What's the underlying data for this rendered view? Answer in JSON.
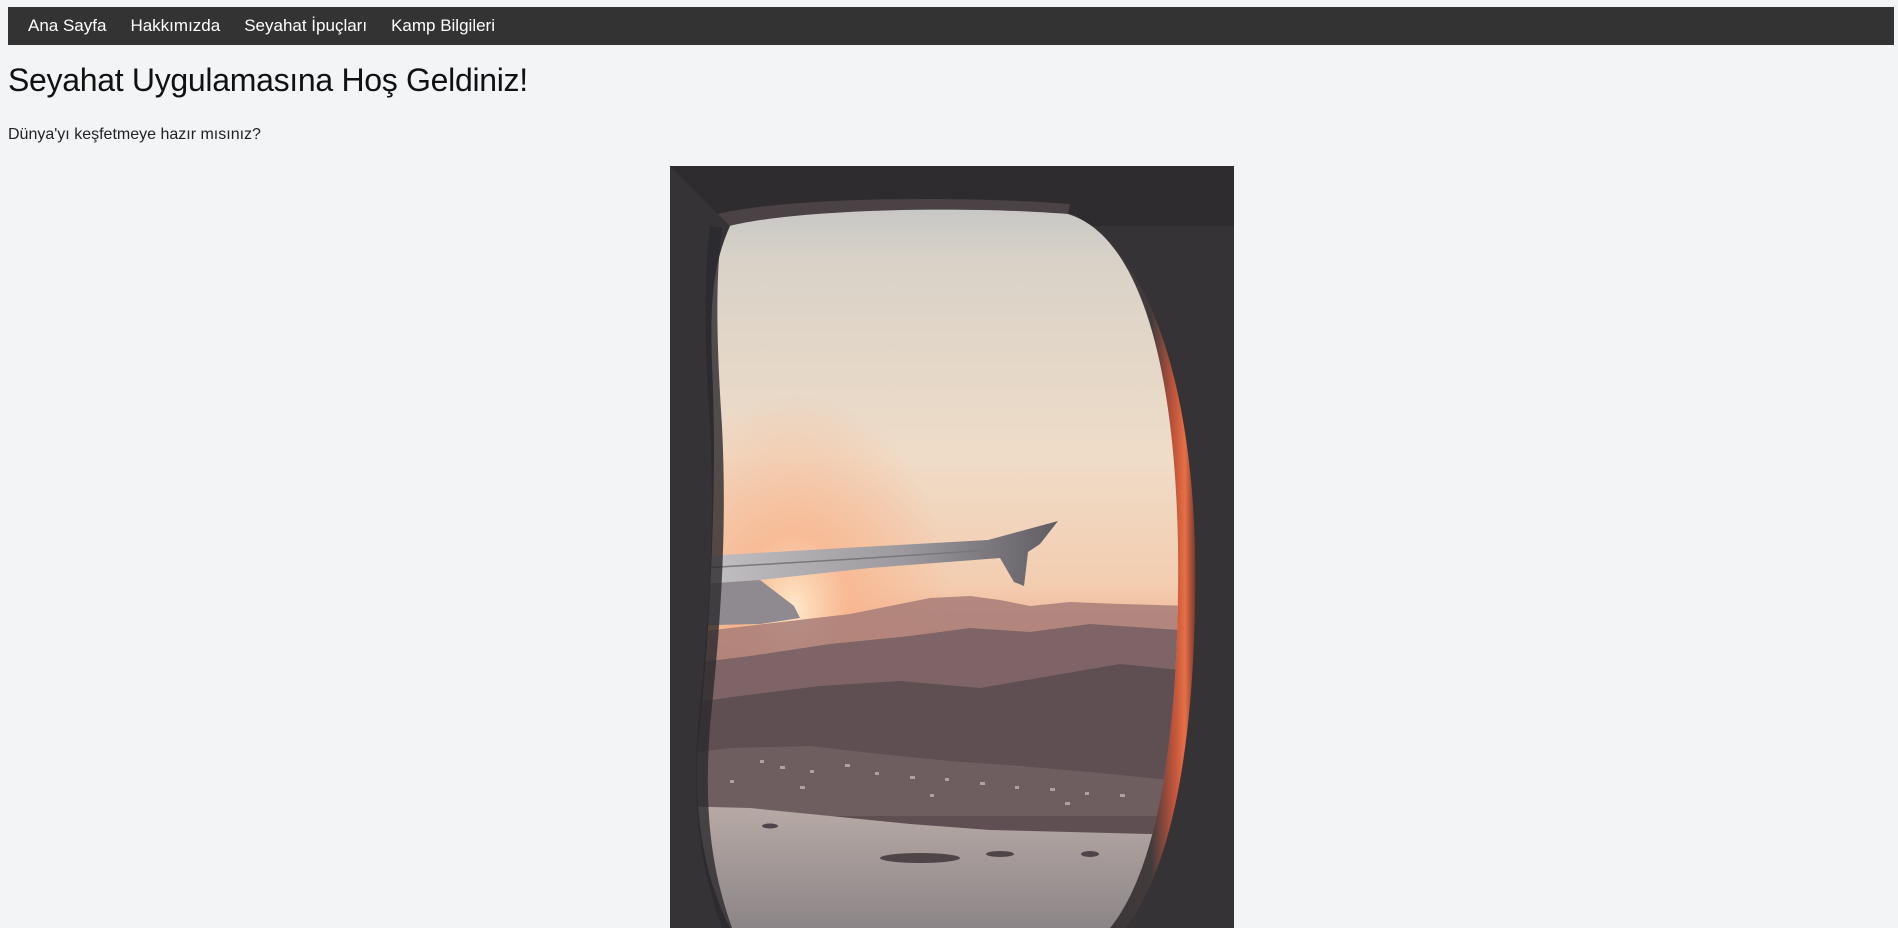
{
  "nav": {
    "items": [
      {
        "label": "Ana Sayfa"
      },
      {
        "label": "Hakkımızda"
      },
      {
        "label": "Seyahat İpuçları"
      },
      {
        "label": "Kamp Bilgileri"
      }
    ]
  },
  "main": {
    "title": "Seyahat Uygulamasına Hoş Geldiniz!",
    "subtitle": "Dünya'yı keşfetmeye hazır mısınız?"
  },
  "hero": {
    "image_subject": "airplane-window-sunset"
  },
  "colors": {
    "navbar_bg": "#333333",
    "page_bg": "#f2f4f6",
    "nav_text": "#ffffff"
  }
}
